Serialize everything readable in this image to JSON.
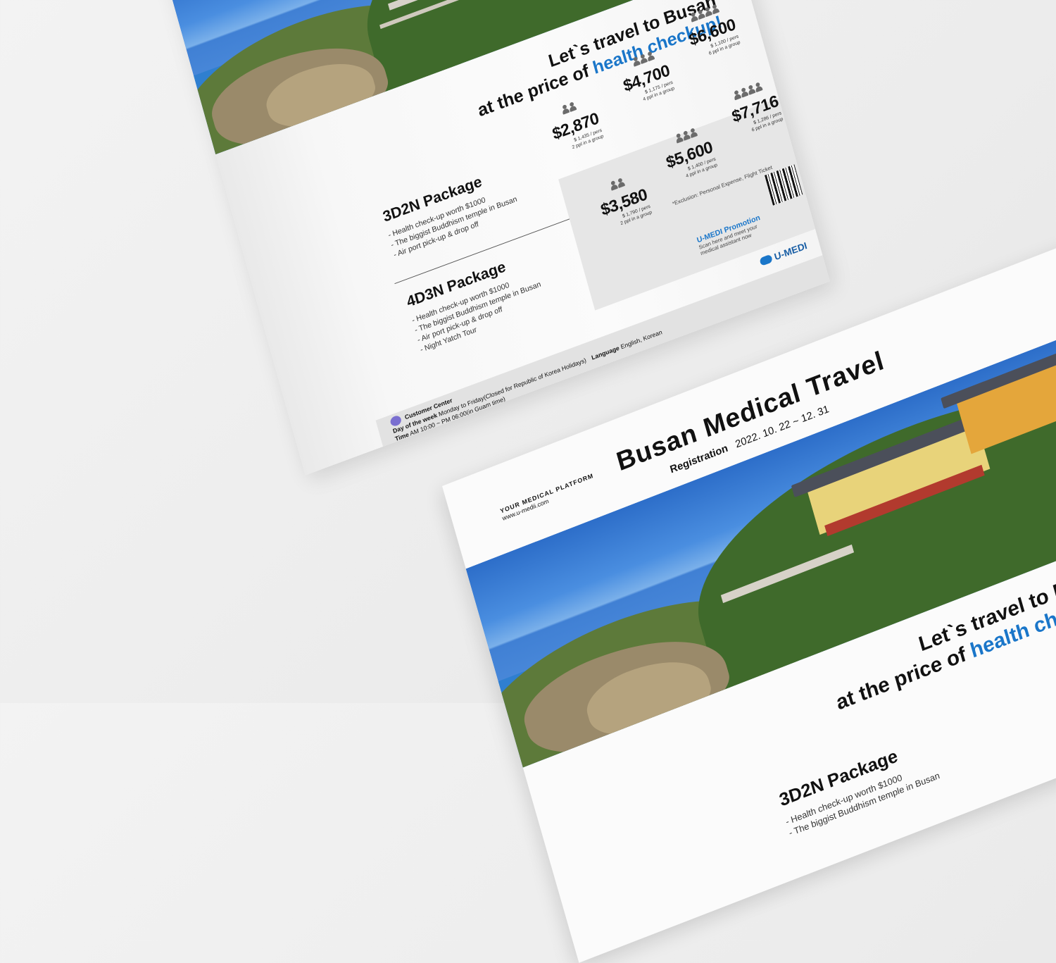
{
  "brand": {
    "logo_text": "U-MEDI",
    "platform_label": "YOUR MEDICAL PLATFORM",
    "url": "www.u-medii.com",
    "accent_color": "#1a76c9"
  },
  "flyer": {
    "title": "Busan Medical Travel",
    "registration_label": "Registration",
    "registration_dates": "2022. 10. 22 ~ 12. 31",
    "headline_line1": "Let`s travel to Busan",
    "headline_line2_prefix": "at the price of",
    "headline_line2_highlight": "health checkup!"
  },
  "packages": [
    {
      "name": "3D2N Package",
      "items": [
        "- Health check-up worth $1000",
        "- The biggist Buddhism temple in Busan",
        "- Air port pick-up & drop off"
      ],
      "prices": [
        {
          "amount": "$2,870",
          "per": "$ 1,435 / pers",
          "group": "2 ppl in a group",
          "icon": "two-people-icon"
        },
        {
          "amount": "$4,700",
          "per": "$ 1,175 / pers",
          "group": "4 ppl in a group",
          "icon": "four-people-icon"
        },
        {
          "amount": "$6,600",
          "per": "$ 1,100 / pers",
          "group": "6 ppl in a group",
          "icon": "six-people-icon"
        }
      ]
    },
    {
      "name": "4D3N Package",
      "items": [
        "- Health check-up worth $1000",
        "- The biggist Buddhism temple in Busan",
        "- Air port pick-up & drop off",
        "- Night Yatch Tour"
      ],
      "prices": [
        {
          "amount": "$3,580",
          "per": "$ 1,790 / pers",
          "group": "2 ppl in a group",
          "icon": "two-people-icon"
        },
        {
          "amount": "$5,600",
          "per": "$ 1,400 / pers",
          "group": "4 ppl in a group",
          "icon": "four-people-icon"
        },
        {
          "amount": "$7,716",
          "per": "$ 1,286 / pers",
          "group": "6 ppl in a group",
          "icon": "six-people-icon"
        }
      ]
    }
  ],
  "exclusion_note": "*Exclusion: Personal Expense, Flight Ticket",
  "promotion": {
    "title": "U-MEDI Promotion",
    "text_line1": "Scan here and meet your",
    "text_line2": "medical assistant now"
  },
  "customer_center": {
    "title": "Customer Center",
    "day_label": "Day of the week",
    "day_value": "Monday to Friday(Closed for Republic of Korea Holidays)",
    "time_label": "Time",
    "time_value": "AM 10:00 ~ PM 06:00(in Guam time)",
    "language_label": "Language",
    "language_value": "English, Korean"
  }
}
